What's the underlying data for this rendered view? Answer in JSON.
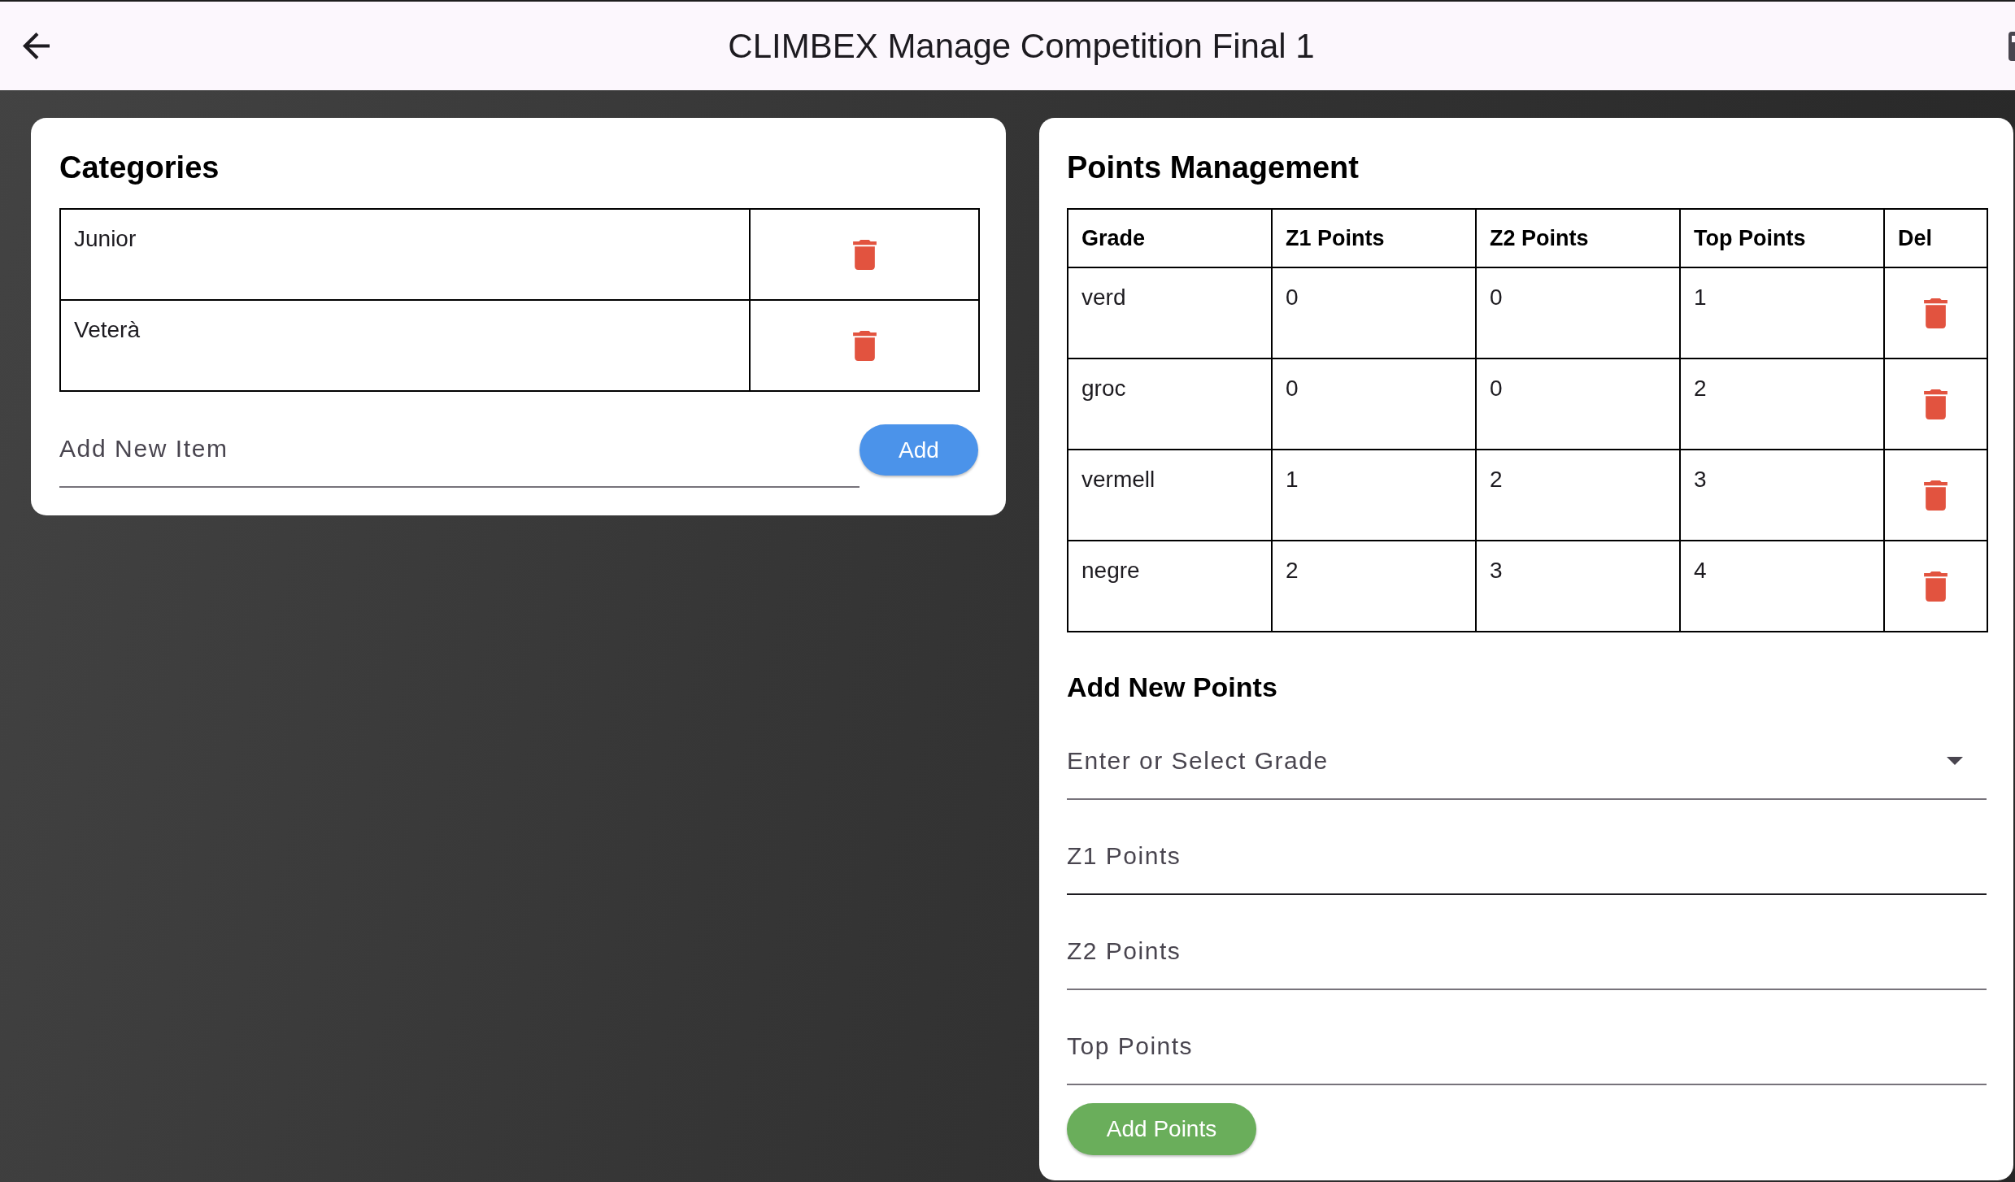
{
  "app_bar": {
    "title": "CLIMBEX Manage Competition Final 1"
  },
  "categories": {
    "title": "Categories",
    "items": [
      "Junior",
      "Veterà"
    ],
    "new_item": {
      "placeholder": "Add New Item"
    },
    "add_button": "Add"
  },
  "points_management": {
    "title": "Points Management",
    "columns": [
      "Grade",
      "Z1 Points",
      "Z2 Points",
      "Top Points",
      "Del"
    ],
    "rows": [
      [
        "verd",
        "0",
        "0",
        "1"
      ],
      [
        "groc",
        "0",
        "0",
        "2"
      ],
      [
        "vermell",
        "1",
        "2",
        "3"
      ],
      [
        "negre",
        "2",
        "3",
        "4"
      ]
    ]
  },
  "add_new_points": {
    "title": "Add New Points",
    "fields": [
      {
        "kind": "dropdown",
        "placeholder": "Enter or Select Grade",
        "hovered": false
      },
      {
        "kind": "text",
        "placeholder": "Z1 Points",
        "hovered": true
      },
      {
        "kind": "text",
        "placeholder": "Z2 Points",
        "hovered": false
      },
      {
        "kind": "text",
        "placeholder": "Top Points",
        "hovered": false
      }
    ],
    "button": "Add Points"
  }
}
